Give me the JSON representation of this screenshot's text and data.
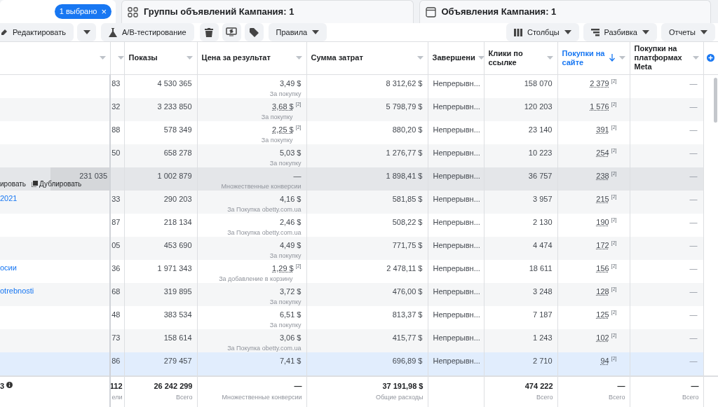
{
  "tabs": [
    {
      "kind": "campaigns",
      "chip": "1 выбрано",
      "chip_close": "×",
      "selected": true
    },
    {
      "kind": "adsets",
      "label": "Группы объявлений Кампания: 1",
      "selected": false
    },
    {
      "kind": "ads",
      "label": "Объявления Кампания: 1",
      "selected": false
    }
  ],
  "toolbar": {
    "left": [
      {
        "kind": "edit",
        "label": "Редактировать"
      },
      {
        "kind": "caret"
      },
      {
        "kind": "ab",
        "label": "A/B-тестирование"
      },
      {
        "kind": "delete"
      },
      {
        "kind": "duplicate"
      },
      {
        "kind": "tag"
      },
      {
        "kind": "rules",
        "label": "Правила"
      }
    ],
    "right": [
      {
        "kind": "columns",
        "label": "Столбцы"
      },
      {
        "kind": "breakdown",
        "label": "Разбивка"
      },
      {
        "kind": "reports",
        "label": "Отчеты"
      }
    ]
  },
  "table": {
    "columns": [
      {
        "kind": "name",
        "sorted": false
      },
      {
        "kind": "results",
        "sorted": false
      },
      {
        "kind": "impressions",
        "label": "Показы",
        "sorted": false
      },
      {
        "kind": "cost",
        "label": "Цена за результат",
        "sorted": false
      },
      {
        "kind": "spend",
        "label": "Сумма затрат",
        "sorted": false
      },
      {
        "kind": "ending",
        "label": "Завершени",
        "sorted": false
      },
      {
        "kind": "clicks",
        "label": "Клики по ссылке",
        "sorted": false
      },
      {
        "kind": "purchases",
        "label": "Покупки на сайте",
        "sorted": true
      },
      {
        "kind": "meta",
        "label": "Покупки на платформах Meta",
        "sorted": false
      }
    ],
    "rows": [
      {
        "hovered": false,
        "selected": false,
        "results": "83",
        "impressions": "4 530 365",
        "cost": "3,49 $",
        "cost_type": "За покупку",
        "spend": "8 312,62 $",
        "ending": "Непрерывн...",
        "clicks": "158 070",
        "purchases": "2 379",
        "purchases_note": "[2]",
        "meta": "—"
      },
      {
        "hovered": false,
        "selected": false,
        "results": "32",
        "impressions": "3 233 850",
        "cost": "3,68 $",
        "cost_note": "[2]",
        "cost_type": "За покупку",
        "spend": "5 798,79 $",
        "ending": "Непрерывн...",
        "clicks": "120 203",
        "purchases": "1 576",
        "purchases_note": "[2]",
        "meta": "—"
      },
      {
        "hovered": false,
        "selected": false,
        "results": "88",
        "impressions": "578 349",
        "cost": "2,25 $",
        "cost_note": "[2]",
        "cost_type": "За покупку",
        "spend": "880,20 $",
        "ending": "Непрерывн...",
        "clicks": "23 140",
        "purchases": "391",
        "purchases_note": "[2]",
        "meta": "—"
      },
      {
        "hovered": false,
        "selected": false,
        "results": "50",
        "impressions": "658 278",
        "cost": "5,03 $",
        "cost_type": "За покупку",
        "spend": "1 276,77 $",
        "ending": "Непрерывн...",
        "clicks": "10 223",
        "purchases": "254",
        "purchases_note": "[2]",
        "meta": "—"
      },
      {
        "hovered": true,
        "selected": false,
        "actions": [
          "ировать",
          "Дублировать"
        ],
        "results": "231 035",
        "impressions": "1 002 879",
        "cost": "—",
        "cost_type": "Множественные конверсии",
        "spend": "1 898,41 $",
        "ending": "Непрерывн...",
        "clicks": "36 757",
        "purchases": "238",
        "purchases_note": "[2]",
        "meta": "—"
      },
      {
        "hovered": false,
        "selected": false,
        "name": "2021",
        "results": "33",
        "impressions": "290 203",
        "cost": "4,16 $",
        "cost_type": "За Покупка obetty.com.ua",
        "spend": "581,85 $",
        "ending": "Непрерывн...",
        "clicks": "3 957",
        "purchases": "215",
        "purchases_note": "[2]",
        "meta": "—"
      },
      {
        "hovered": false,
        "selected": false,
        "results": "87",
        "impressions": "218 134",
        "cost": "2,46 $",
        "cost_type": "За Покупка obetty.com.ua",
        "spend": "508,22 $",
        "ending": "Непрерывн...",
        "clicks": "2 130",
        "purchases": "190",
        "purchases_note": "[2]",
        "meta": "—"
      },
      {
        "hovered": false,
        "selected": false,
        "results": "05",
        "impressions": "453 690",
        "cost": "4,49 $",
        "cost_type": "За покупку",
        "spend": "771,75 $",
        "ending": "Непрерывн...",
        "clicks": "4 474",
        "purchases": "172",
        "purchases_note": "[2]",
        "meta": "—"
      },
      {
        "hovered": false,
        "selected": false,
        "name": "осии",
        "results": "36",
        "impressions": "1 971 343",
        "cost": "1,29 $",
        "cost_note": "[2]",
        "cost_type": "За добавление в корзину",
        "spend": "2 478,11 $",
        "ending": "Непрерывн...",
        "clicks": "18 611",
        "purchases": "156",
        "purchases_note": "[2]",
        "meta": "—"
      },
      {
        "hovered": false,
        "selected": false,
        "name": "otrebnosti",
        "results": "68",
        "impressions": "319 895",
        "cost": "3,72 $",
        "cost_type": "За покупку",
        "spend": "476,00 $",
        "ending": "Непрерывн...",
        "clicks": "3 248",
        "purchases": "128",
        "purchases_note": "[2]",
        "meta": "—"
      },
      {
        "hovered": false,
        "selected": false,
        "results": "48",
        "impressions": "383 534",
        "cost": "6,51 $",
        "cost_type": "За покупку",
        "spend": "813,37 $",
        "ending": "Непрерывн...",
        "clicks": "7 187",
        "purchases": "125",
        "purchases_note": "[2]",
        "meta": "—"
      },
      {
        "hovered": false,
        "selected": false,
        "results": "73",
        "impressions": "158 614",
        "cost": "3,06 $",
        "cost_type": "За Покупка obetty.com.ua",
        "spend": "415,77 $",
        "ending": "Непрерывн...",
        "clicks": "1 243",
        "purchases": "102",
        "purchases_note": "[2]",
        "meta": "—"
      },
      {
        "hovered": false,
        "selected": true,
        "results": "86",
        "impressions": "279 457",
        "cost": "7,41 $",
        "spend": "696,89 $",
        "ending": "Непрерывн...",
        "clicks": "2 710",
        "purchases": "94",
        "purchases_note": "[2]",
        "meta": "—"
      }
    ],
    "totals": {
      "name": "3",
      "results": "112",
      "results_sub": "ели",
      "impressions": "26 242 299",
      "impressions_sub": "Всего",
      "cost": "—",
      "cost_sub": "Множественные конверсии",
      "spend": "37 191,98 $",
      "spend_sub": "Общие расходы",
      "clicks": "474 222",
      "clicks_sub": "Всего",
      "purchases": "—",
      "purchases_sub": "Всего",
      "meta": "—",
      "meta_sub": "Всего"
    }
  }
}
